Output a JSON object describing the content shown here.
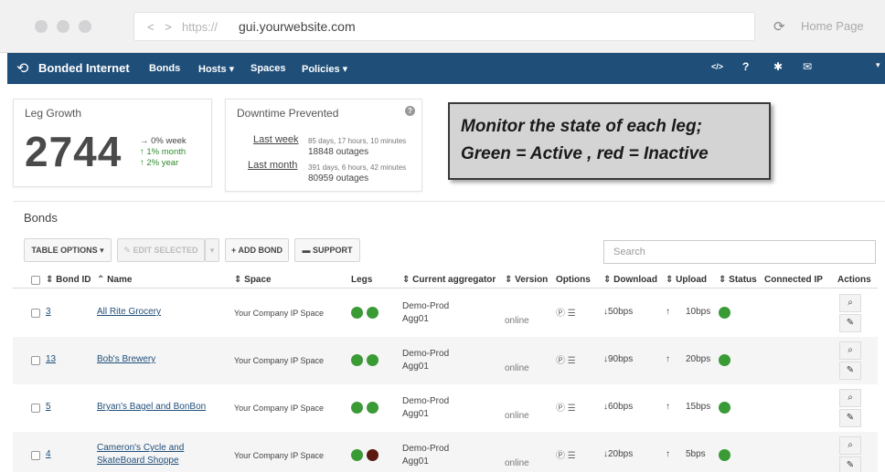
{
  "browser": {
    "nav_arrows": "< >",
    "protocol": "https://",
    "host": "gui.yourwebsite.com",
    "home_label": "Home Page"
  },
  "navbar": {
    "brand": "Bonded Internet",
    "items": [
      "Bonds",
      "Hosts ▾",
      "Spaces",
      "Policies ▾"
    ],
    "right_icons": [
      "code-icon",
      "help-icon",
      "gear-icon",
      "mail-icon"
    ]
  },
  "leg_growth": {
    "title": "Leg Growth",
    "value": "2744",
    "stats": [
      "→ 0% week",
      "↑ 1% month",
      "↑ 2% year"
    ]
  },
  "downtime": {
    "title": "Downtime Prevented",
    "help": "?",
    "periods": [
      {
        "label": "Last week",
        "detail": "85 days, 17 hours, 10 minutes",
        "count": "18848 outages"
      },
      {
        "label": "Last month",
        "detail": "391 days, 6 hours, 42 minutes",
        "count": "80959 outages"
      }
    ]
  },
  "callout": {
    "line1": "Monitor the state of each leg;",
    "line2": "Green = Active , red = Inactive"
  },
  "bonds": {
    "title": "Bonds",
    "buttons": {
      "table_options": "TABLE OPTIONS ▾",
      "edit_selected": "✎ EDIT SELECTED",
      "edit_caret": "▾",
      "add_bond": "+ ADD BOND",
      "support": "▬ SUPPORT"
    },
    "search_placeholder": "Search",
    "columns": [
      "⇕ Bond ID",
      "⌃ Name",
      "⇕ Space",
      "Legs",
      "⇕ Current aggregator",
      "⇕ Version",
      "Options",
      "⇕ Download",
      "⇕ Upload",
      "⇕ Status",
      "Connected IP",
      "Actions"
    ],
    "rows": [
      {
        "id": "3",
        "name": [
          "All Rite Grocery"
        ],
        "space": "Your Company IP Space",
        "legs": [
          "#3a9a35",
          "#3a9a35"
        ],
        "aggregator": [
          "Demo-Prod",
          "Agg01"
        ],
        "version": "online",
        "options": "Ⓟ ☰",
        "download": "↓50bps",
        "upload": "10bps",
        "status_color": "#3a9a35"
      },
      {
        "id": "13",
        "name": [
          "Bob's Brewery"
        ],
        "space": "Your Company IP Space",
        "legs": [
          "#3a9a35",
          "#3a9a35"
        ],
        "aggregator": [
          "Demo-Prod",
          "Agg01"
        ],
        "version": "online",
        "options": "Ⓟ ☰",
        "download": "↓90bps",
        "upload": "20bps",
        "status_color": "#3a9a35"
      },
      {
        "id": "5",
        "name": [
          "Bryan's Bagel and BonBon"
        ],
        "space": "Your Company IP Space",
        "legs": [
          "#3a9a35",
          "#3a9a35"
        ],
        "aggregator": [
          "Demo-Prod",
          "Agg01"
        ],
        "version": "online",
        "options": "Ⓟ ☰",
        "download": "↓60bps",
        "upload": "15bps",
        "status_color": "#3a9a35"
      },
      {
        "id": "4",
        "name": [
          "Cameron's Cycle and",
          "SkateBoard Shoppe"
        ],
        "space": "Your Company IP Space",
        "legs": [
          "#3a9a35",
          "#5a1a10"
        ],
        "aggregator": [
          "Demo-Prod",
          "Agg01"
        ],
        "version": "online",
        "options": "Ⓟ ☰",
        "download": "↓20bps",
        "upload": "5bps",
        "status_color": "#3a9a35"
      }
    ]
  },
  "colors": {
    "nav_bg": "#1f4e79",
    "active": "#3a9a35",
    "inactive": "#5a1a10",
    "trend_up": "#2e8b2e"
  }
}
